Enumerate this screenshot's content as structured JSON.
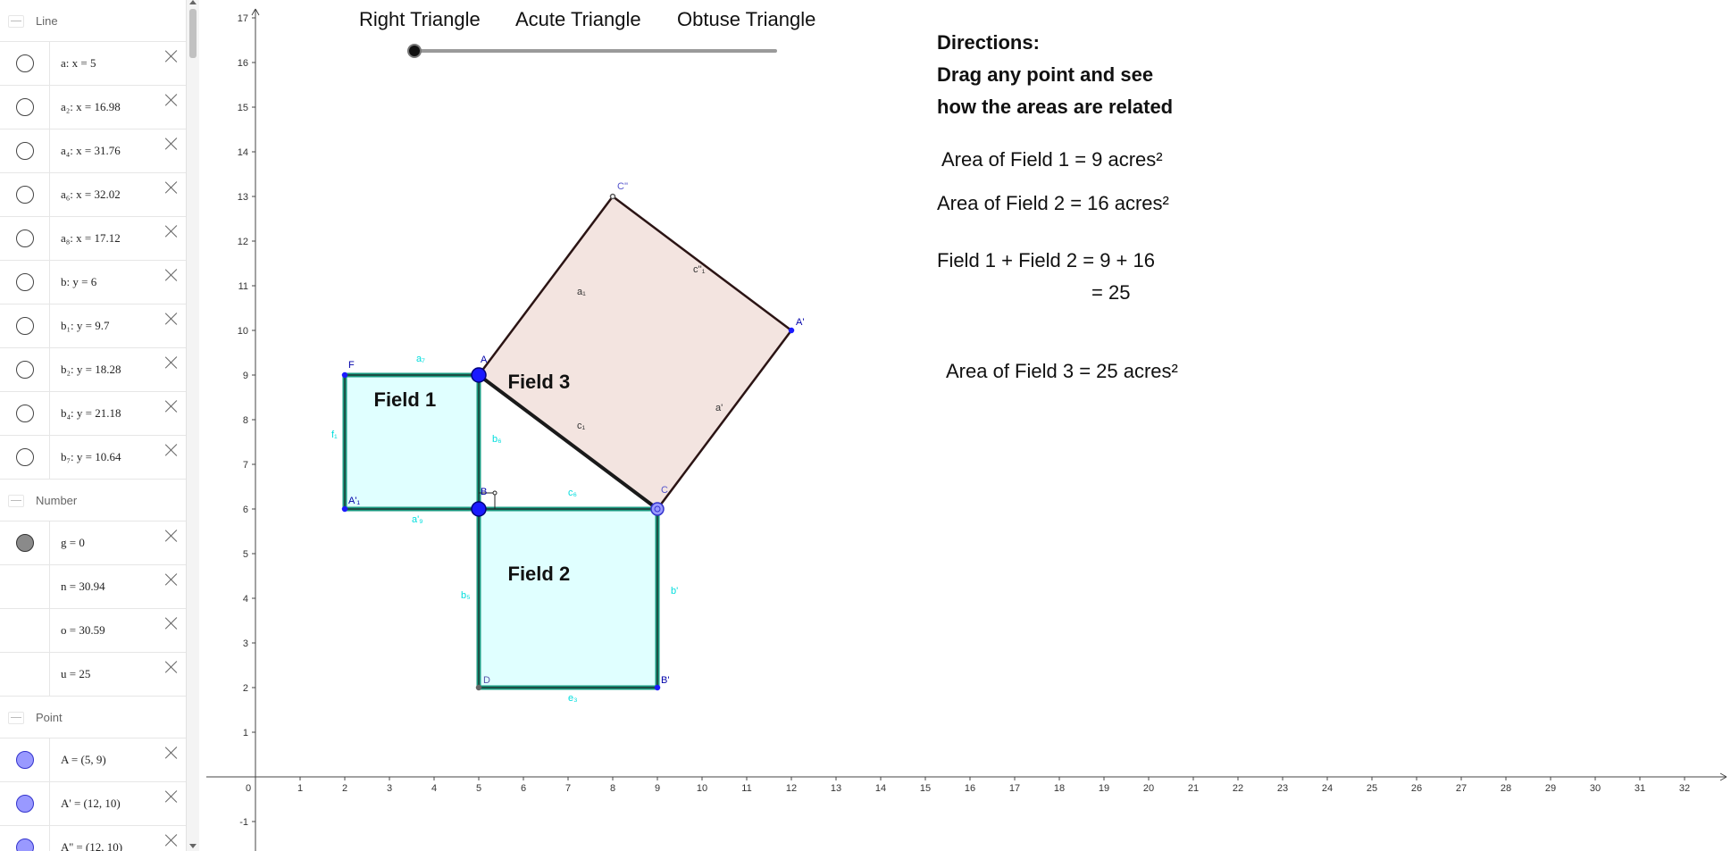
{
  "algebra": {
    "groups": [
      {
        "name": "Line",
        "items": [
          {
            "label": "a: x = 5",
            "dot": "white"
          },
          {
            "label": "a₂: x = 16.98",
            "dot": "white"
          },
          {
            "label": "a₄: x = 31.76",
            "dot": "white"
          },
          {
            "label": "a₆: x = 32.02",
            "dot": "white"
          },
          {
            "label": "a₈: x = 17.12",
            "dot": "white"
          },
          {
            "label": "b: y = 6",
            "dot": "white"
          },
          {
            "label": "b₁: y = 9.7",
            "dot": "white"
          },
          {
            "label": "b₂: y = 18.28",
            "dot": "white"
          },
          {
            "label": "b₄: y = 21.18",
            "dot": "white"
          },
          {
            "label": "b₇: y = 10.64",
            "dot": "white"
          }
        ]
      },
      {
        "name": "Number",
        "items": [
          {
            "label": "g = 0",
            "dot": "gray"
          },
          {
            "label": "n = 30.94",
            "dot": "none"
          },
          {
            "label": "o = 30.59",
            "dot": "none"
          },
          {
            "label": "u = 25",
            "dot": "none"
          }
        ]
      },
      {
        "name": "Point",
        "items": [
          {
            "label": "A = (5, 9)",
            "dot": "blue"
          },
          {
            "label": "A' = (12, 10)",
            "dot": "blue"
          },
          {
            "label": "A'' = (12, 10)",
            "dot": "blue"
          }
        ]
      }
    ]
  },
  "slider": {
    "labels": [
      "Right Triangle",
      "Acute Triangle",
      "Obtuse Triangle"
    ],
    "value": 0
  },
  "directions": {
    "lines": [
      "Directions:",
      "Drag any point and see",
      "how the areas are related"
    ]
  },
  "areas": {
    "field1": "Area of Field 1 = 9 acres²",
    "field2": "Area of Field 2 = 16 acres²",
    "sum_line1": "Field 1 + Field 2 = 9 + 16",
    "sum_line2": "= 25",
    "field3": "Area of Field 3 = 25 acres²"
  },
  "axes": {
    "x_ticks": [
      "0",
      "1",
      "2",
      "3",
      "4",
      "5",
      "6",
      "7",
      "8",
      "9",
      "10",
      "11",
      "12",
      "13",
      "14",
      "15",
      "16",
      "17",
      "18",
      "19",
      "20",
      "21",
      "22",
      "23",
      "24",
      "25",
      "26",
      "27",
      "28",
      "29",
      "30",
      "31",
      "32"
    ],
    "y_ticks": [
      "-1",
      "1",
      "2",
      "3",
      "4",
      "5",
      "6",
      "7",
      "8",
      "9",
      "10",
      "11",
      "12",
      "13",
      "14",
      "15",
      "16",
      "17"
    ]
  },
  "figure": {
    "field_labels": {
      "f1": "Field 1",
      "f2": "Field 2",
      "f3": "Field 3"
    },
    "points": {
      "A": {
        "label": "A",
        "x": 5,
        "y": 9
      },
      "B": {
        "label": "B",
        "x": 5,
        "y": 6
      },
      "C": {
        "label": "C",
        "x": 9,
        "y": 6
      },
      "F": {
        "label": "F",
        "x": 2,
        "y": 9
      },
      "A1": {
        "label": "A'₁",
        "x": 2,
        "y": 6
      },
      "D": {
        "label": "D",
        "x": 5,
        "y": 2
      },
      "Bp": {
        "label": "B'",
        "x": 9,
        "y": 2
      },
      "Ap": {
        "label": "A'",
        "x": 12,
        "y": 10
      },
      "Cpp": {
        "label": "C''",
        "x": 8,
        "y": 13
      }
    },
    "segment_labels": [
      {
        "text": "a₇",
        "x": 3.6,
        "y": 9.3,
        "color": "#00dddd"
      },
      {
        "text": "f₁",
        "x": 1.7,
        "y": 7.6,
        "color": "#00dddd"
      },
      {
        "text": "b₆",
        "x": 5.3,
        "y": 7.5,
        "color": "#00dddd"
      },
      {
        "text": "a'₉",
        "x": 3.5,
        "y": 5.7,
        "color": "#00dddd"
      },
      {
        "text": "c₆",
        "x": 7.0,
        "y": 6.3,
        "color": "#00dddd"
      },
      {
        "text": "b₅",
        "x": 4.6,
        "y": 4.0,
        "color": "#00dddd"
      },
      {
        "text": "b'",
        "x": 9.3,
        "y": 4.1,
        "color": "#00dddd"
      },
      {
        "text": "e₃",
        "x": 7.0,
        "y": 1.7,
        "color": "#00dddd"
      },
      {
        "text": "a₁",
        "x": 7.2,
        "y": 10.8,
        "color": "#333"
      },
      {
        "text": "c''₁",
        "x": 9.8,
        "y": 11.3,
        "color": "#333"
      },
      {
        "text": "c₁",
        "x": 7.2,
        "y": 7.8,
        "color": "#333"
      },
      {
        "text": "a'",
        "x": 10.3,
        "y": 8.2,
        "color": "#333"
      }
    ],
    "colors": {
      "square_fill": "#e0ffff",
      "square_stroke": "#1a9a80",
      "field3_fill": "#f3e4e0",
      "point": "#0000ff"
    }
  }
}
